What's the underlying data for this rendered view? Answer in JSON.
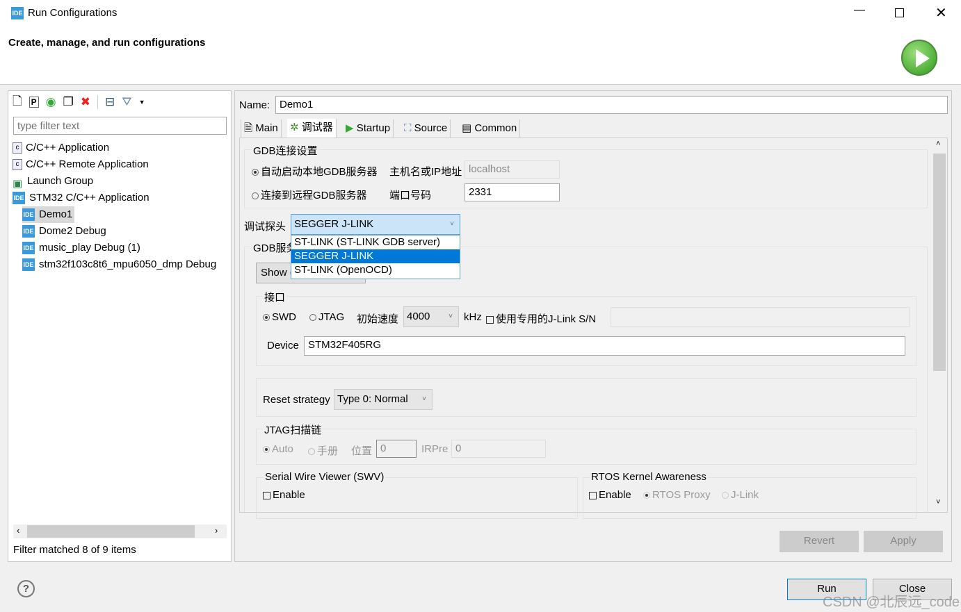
{
  "window": {
    "title": "Run Configurations",
    "minimize_icon": "minimize-icon",
    "maximize_icon": "maximize-icon",
    "close_icon": "close-icon"
  },
  "header": {
    "subtitle": "Create, manage, and run configurations",
    "run_icon": "green-play-icon"
  },
  "sidebar": {
    "toolbar": [
      "new-config-icon",
      "new-prototype-icon",
      "export-icon",
      "duplicate-icon",
      "delete-icon",
      "collapse-all-icon",
      "filter-icon",
      "dropdown-arrow-icon"
    ],
    "filter_placeholder": "type filter text",
    "items": [
      {
        "label": "C/C++ Application",
        "icon": "c-app-icon",
        "level": 0
      },
      {
        "label": "C/C++ Remote Application",
        "icon": "c-app-icon",
        "level": 0
      },
      {
        "label": "Launch Group",
        "icon": "launch-group-icon",
        "level": 0
      },
      {
        "label": "STM32 C/C++ Application",
        "icon": "ide-icon",
        "level": 0
      },
      {
        "label": "Demo1",
        "icon": "ide-icon",
        "level": 1,
        "selected": true
      },
      {
        "label": "Dome2 Debug",
        "icon": "ide-icon",
        "level": 1
      },
      {
        "label": "music_play Debug (1)",
        "icon": "ide-icon",
        "level": 1
      },
      {
        "label": "stm32f103c8t6_mpu6050_dmp Debug",
        "icon": "ide-icon",
        "level": 1
      }
    ],
    "status": "Filter matched 8 of 9 items"
  },
  "main": {
    "name_label": "Name:",
    "name_value": "Demo1",
    "tabs": [
      {
        "label": "Main"
      },
      {
        "label": "调试器",
        "active": true
      },
      {
        "label": "Startup"
      },
      {
        "label": "Source"
      },
      {
        "label": "Common"
      }
    ],
    "gdb_conn": {
      "title": "GDB连接设置",
      "auto_label": "自动启动本地GDB服务器",
      "remote_label": "连接到远程GDB服务器",
      "host_label": "主机名或IP地址",
      "host_value": "localhost",
      "port_label": "端口号码",
      "port_value": "2331",
      "selected": "auto"
    },
    "probe": {
      "label": "调试探头",
      "value": "SEGGER J-LINK",
      "options": [
        "ST-LINK (ST-LINK GDB server)",
        "SEGGER J-LINK",
        "ST-LINK (OpenOCD)"
      ],
      "highlighted": 1
    },
    "gdb_server": {
      "title": "GDB服务",
      "show_button": "Show ("
    },
    "interface": {
      "title": "接口",
      "swd": "SWD",
      "jtag": "JTAG",
      "selected": "SWD",
      "speed_label": "初始速度",
      "speed_value": "4000",
      "speed_unit": "kHz",
      "sn_label": "使用专用的J-Link S/N",
      "sn_value": "",
      "device_label": "Device",
      "device_value": "STM32F405RG"
    },
    "reset": {
      "label": "Reset strategy",
      "value": "Type 0: Normal"
    },
    "jtag_chain": {
      "title": "JTAG扫描链",
      "auto": "Auto",
      "manual": "手册",
      "pos_label": "位置",
      "pos_value": "0",
      "irpre_label": "IRPre",
      "irpre_value": "0"
    },
    "swv": {
      "title": "Serial Wire Viewer (SWV)",
      "enable": "Enable"
    },
    "rtos": {
      "title": "RTOS Kernel Awareness",
      "enable": "Enable",
      "proxy": "RTOS Proxy",
      "jlink": "J-Link"
    },
    "revert": "Revert",
    "apply": "Apply"
  },
  "footer": {
    "help_icon": "help-icon",
    "run": "Run",
    "close": "Close",
    "watermark": "CSDN @北辰远_code"
  }
}
